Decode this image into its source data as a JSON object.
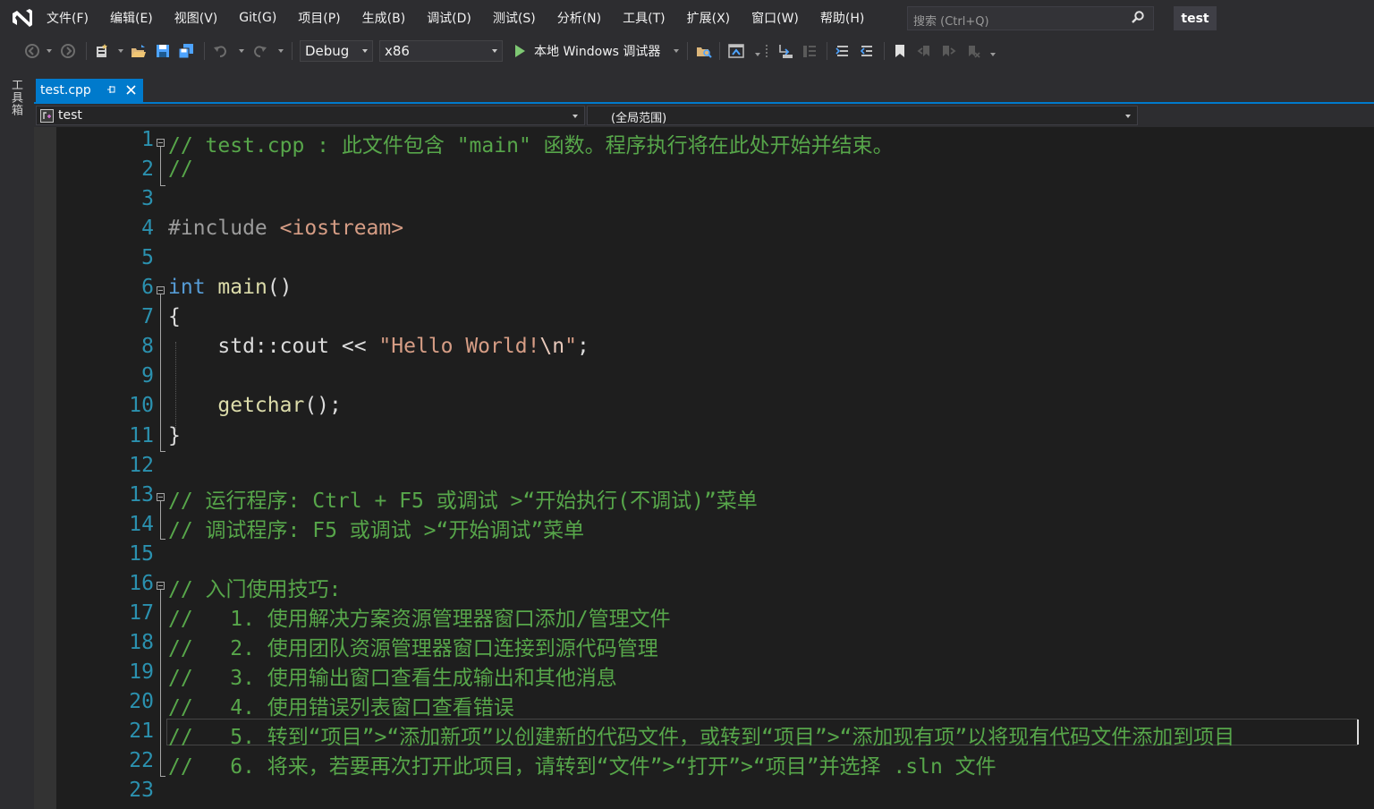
{
  "menu": {
    "items": [
      "文件(F)",
      "编辑(E)",
      "视图(V)",
      "Git(G)",
      "项目(P)",
      "生成(B)",
      "调试(D)",
      "测试(S)",
      "分析(N)",
      "工具(T)",
      "扩展(X)",
      "窗口(W)",
      "帮助(H)"
    ],
    "search_placeholder": "搜索 (Ctrl+Q)",
    "solution_name": "test"
  },
  "toolbar": {
    "configuration": "Debug",
    "platform": "x86",
    "run_label": "本地 Windows 调试器"
  },
  "toolbox": {
    "label": "工具箱"
  },
  "tabs": [
    {
      "label": "test.cpp",
      "active": true
    }
  ],
  "navbar": {
    "project": "test",
    "scope": "(全局范围)"
  },
  "editor": {
    "current_line": 21,
    "lines": [
      {
        "n": "1",
        "tokens": [
          [
            "comment",
            "// test.cpp : 此文件包含 \"main\" 函数。程序执行将在此处开始并结束。"
          ]
        ]
      },
      {
        "n": "2",
        "tokens": [
          [
            "comment",
            "//"
          ]
        ]
      },
      {
        "n": "3",
        "tokens": []
      },
      {
        "n": "4",
        "tokens": [
          [
            "prepro",
            "#include "
          ],
          [
            "string",
            "<iostream>"
          ]
        ]
      },
      {
        "n": "5",
        "tokens": []
      },
      {
        "n": "6",
        "tokens": [
          [
            "keyword",
            "int"
          ],
          [
            "punct",
            " "
          ],
          [
            "func",
            "main"
          ],
          [
            "punct",
            "()"
          ]
        ]
      },
      {
        "n": "7",
        "tokens": [
          [
            "punct",
            "{"
          ]
        ]
      },
      {
        "n": "8",
        "tokens": [
          [
            "punct",
            "    std::cout << "
          ],
          [
            "string",
            "\"Hello World!"
          ],
          [
            "escape",
            "\\n"
          ],
          [
            "string",
            "\""
          ],
          [
            "punct",
            ";"
          ]
        ]
      },
      {
        "n": "9",
        "tokens": []
      },
      {
        "n": "10",
        "tokens": [
          [
            "punct",
            "    "
          ],
          [
            "func",
            "getchar"
          ],
          [
            "punct",
            "();"
          ]
        ]
      },
      {
        "n": "11",
        "tokens": [
          [
            "punct",
            "}"
          ]
        ]
      },
      {
        "n": "12",
        "tokens": []
      },
      {
        "n": "13",
        "tokens": [
          [
            "comment",
            "// 运行程序: Ctrl + F5 或调试 >“开始执行(不调试)”菜单"
          ]
        ]
      },
      {
        "n": "14",
        "tokens": [
          [
            "comment",
            "// 调试程序: F5 或调试 >“开始调试”菜单"
          ]
        ]
      },
      {
        "n": "15",
        "tokens": []
      },
      {
        "n": "16",
        "tokens": [
          [
            "comment",
            "// 入门使用技巧:"
          ]
        ]
      },
      {
        "n": "17",
        "tokens": [
          [
            "comment",
            "//   1. 使用解决方案资源管理器窗口添加/管理文件"
          ]
        ]
      },
      {
        "n": "18",
        "tokens": [
          [
            "comment",
            "//   2. 使用团队资源管理器窗口连接到源代码管理"
          ]
        ]
      },
      {
        "n": "19",
        "tokens": [
          [
            "comment",
            "//   3. 使用输出窗口查看生成输出和其他消息"
          ]
        ]
      },
      {
        "n": "20",
        "tokens": [
          [
            "comment",
            "//   4. 使用错误列表窗口查看错误"
          ]
        ]
      },
      {
        "n": "21",
        "tokens": [
          [
            "comment",
            "//   5. 转到“项目”>“添加新项”以创建新的代码文件，或转到“项目”>“添加现有项”以将现有代码文件添加到项目"
          ]
        ]
      },
      {
        "n": "22",
        "tokens": [
          [
            "comment",
            "//   6. 将来，若要再次打开此项目，请转到“文件”>“打开”>“项目”并选择 .sln 文件"
          ]
        ]
      },
      {
        "n": "23",
        "tokens": []
      }
    ]
  },
  "colors": {
    "accent": "#007acc",
    "comment": "#57a64a",
    "keyword": "#569cd6",
    "string": "#d69d85",
    "line_number": "#2b91af",
    "editor_bg": "#1e1e1e",
    "chrome_bg": "#2d2d30"
  }
}
